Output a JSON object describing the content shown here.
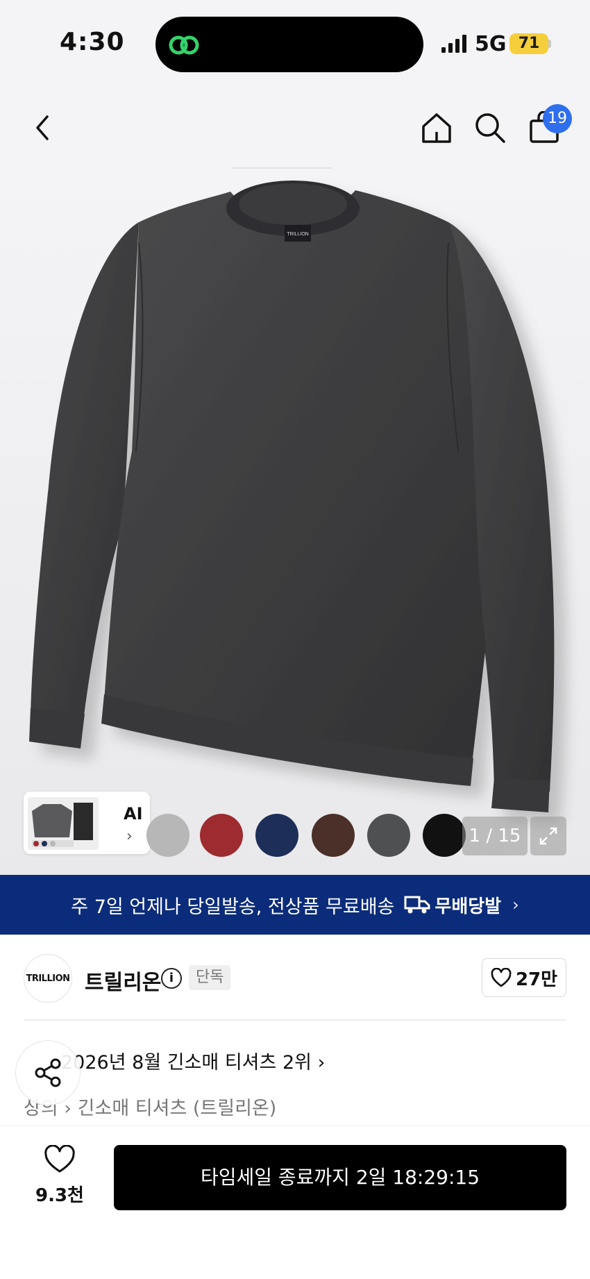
{
  "status_bar": {
    "time": "4:30",
    "network": "5G",
    "battery": "71",
    "accent_color": "#f5cf3b"
  },
  "nav": {
    "back_icon": "chevron-left-icon",
    "home_icon": "home-icon",
    "search_icon": "search-icon",
    "cart_icon": "shopping-bag-icon",
    "cart_count": "19"
  },
  "gallery": {
    "ai_label": "AI",
    "pager": "1 / 15",
    "swatch_colors": [
      "#b7b7b7",
      "#9e2b30",
      "#1d2f58",
      "#4a3028",
      "#4f5052",
      "#111111"
    ]
  },
  "banner": {
    "text": "주 7일 언제나 당일발송, 전상품 무료배송",
    "brand": "무배당발",
    "color": "#0b2c7a"
  },
  "store": {
    "logo_text": "TRILLION",
    "name": "트릴리온",
    "exclusive_badge": "단독",
    "likes": "27만"
  },
  "ranking": {
    "text": "2026년 8월 긴소매 티셔츠 2위"
  },
  "breadcrumb": {
    "parent": "상의",
    "child": "긴소매 티셔츠 (트릴리온)"
  },
  "bottom": {
    "wish_count": "9.3천",
    "buy_label": "타임세일 종료까지 2일 18:29:15"
  }
}
